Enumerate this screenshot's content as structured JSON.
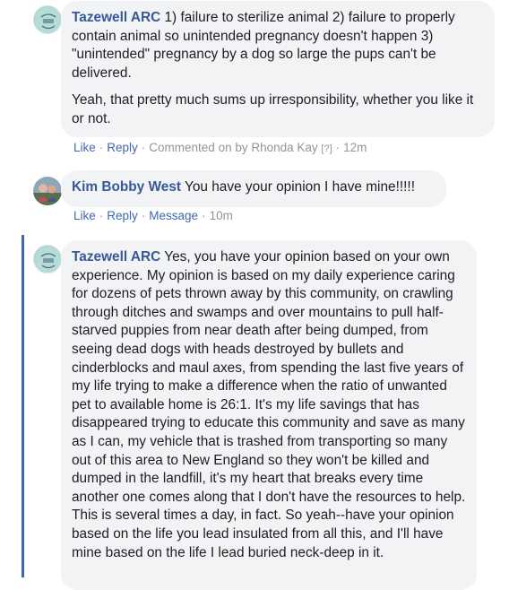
{
  "comments": [
    {
      "author": "Tazewell ARC",
      "paragraphs": [
        "1) failure to sterilize animal 2) failure to properly contain animal so unintended pregnancy doesn't happen 3) \"unintended\" pregnancy by a dog so large the pups can't be delivered.",
        "Yeah, that pretty much sums up irresponsibility, whether you like it or not."
      ],
      "actions": {
        "like": "Like",
        "reply": "Reply",
        "commented_on_by": "Commented on by Rhonda Kay",
        "help": "[?]",
        "time": "12m"
      }
    },
    {
      "author": "Kim Bobby West",
      "paragraphs": [
        "You have your opinion I have mine!!!!!"
      ],
      "actions": {
        "like": "Like",
        "reply": "Reply",
        "message": "Message",
        "time": "10m"
      }
    },
    {
      "author": "Tazewell ARC",
      "paragraphs": [
        "Yes, you have your opinion based on your own experience. My opinion is based on my daily experience caring for dozens of pets thrown away by this community, on crawling through ditches and swamps and over mountains to pull half-starved puppies from near death after being dumped, from seeing dead dogs with heads destroyed by bullets and cinderblocks and maul axes, from spending the last five years of my life trying to make a difference when the ratio of unwanted pet to available home is 26:1. It's my life savings that has disappeared trying to educate this community and save as many as I can, my vehicle that is trashed from transporting so many out of this area to New England so they won't be killed and dumped in the landfill, it's my heart that breaks every time another one comes along that I don't have the resources to help. This is several times a day, in fact. So yeah--have your opinion based on the life you lead insulated from all this, and I'll have mine based on the life I lead buried neck-deep in it."
      ]
    }
  ],
  "colors": {
    "author": "#385898",
    "link": "#4267b2",
    "muted": "#90949c",
    "bubble": "#f2f3f5",
    "highlight_bar": "#4267b2"
  },
  "icons": {
    "arc_avatar": "tazewell-arc-logo",
    "kim_avatar": "profile-photo"
  }
}
